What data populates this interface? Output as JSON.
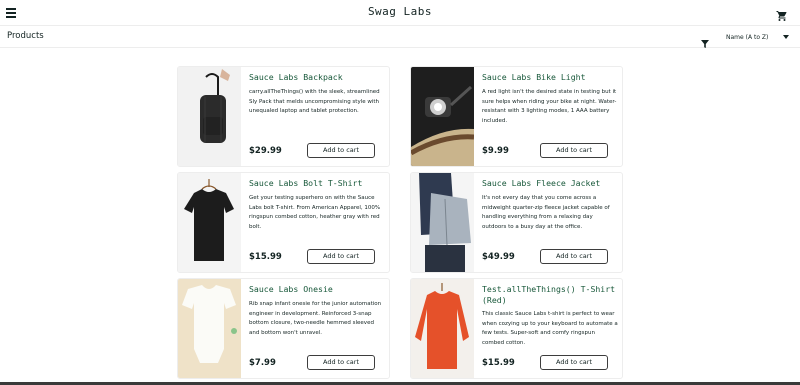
{
  "header": {
    "app_title": "Swag Labs",
    "menu_icon": "menu-icon",
    "cart_icon": "shopping-cart-icon"
  },
  "subheader": {
    "title": "Products",
    "filter_icon": "filter-icon",
    "sort": {
      "selected": "Name (A to Z)"
    }
  },
  "colors": {
    "item_name": "#18583a",
    "text": "#132322",
    "border": "#ededed"
  },
  "items": [
    {
      "name": "Sauce Labs Backpack",
      "desc": "carry.allTheThings() with the sleek, streamlined Sly Pack that melds uncompromising style with unequaled laptop and tablet protection.",
      "price": "$29.99",
      "button": "Add to cart",
      "image": "backpack"
    },
    {
      "name": "Sauce Labs Bike Light",
      "desc": "A red light isn't the desired state in testing but it sure helps when riding your bike at night. Water-resistant with 3 lighting modes, 1 AAA battery included.",
      "price": "$9.99",
      "button": "Add to cart",
      "image": "bike-light"
    },
    {
      "name": "Sauce Labs Bolt T-Shirt",
      "desc": "Get your testing superhero on with the Sauce Labs bolt T-shirt. From American Apparel, 100% ringspun combed cotton, heather gray with red bolt.",
      "price": "$15.99",
      "button": "Add to cart",
      "image": "black-tshirt"
    },
    {
      "name": "Sauce Labs Fleece Jacket",
      "desc": "It's not every day that you come across a midweight quarter-zip fleece jacket capable of handling everything from a relaxing day outdoors to a busy day at the office.",
      "price": "$49.99",
      "button": "Add to cart",
      "image": "fleece-jacket"
    },
    {
      "name": "Sauce Labs Onesie",
      "desc": "Rib snap infant onesie for the junior automation engineer in development. Reinforced 3-snap bottom closure, two-needle hemmed sleeved and bottom won't unravel.",
      "price": "$7.99",
      "button": "Add to cart",
      "image": "onesie"
    },
    {
      "name": "Test.allTheThings() T-Shirt (Red)",
      "desc": "This classic Sauce Labs t-shirt is perfect to wear when cozying up to your keyboard to automate a few tests. Super-soft and comfy ringspun combed cotton.",
      "price": "$15.99",
      "button": "Add to cart",
      "image": "red-sweater"
    }
  ]
}
